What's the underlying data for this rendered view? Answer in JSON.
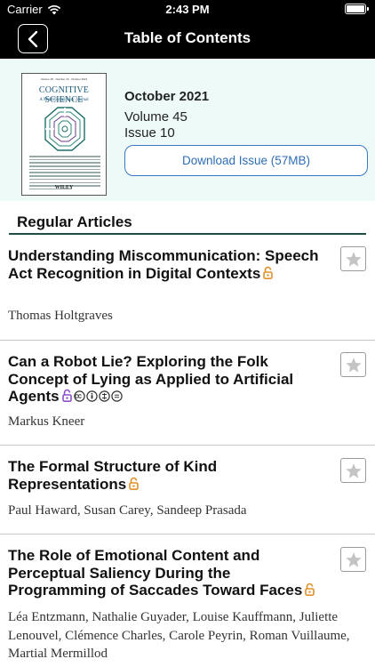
{
  "status_bar": {
    "carrier": "Carrier",
    "time": "2:43 PM"
  },
  "nav": {
    "title": "Table of Contents"
  },
  "issue": {
    "cover": {
      "top_text": "Volume 45 · Number 10 · October 2021",
      "journal_title": "COGNITIVE SCIENCE",
      "journal_subtitle": "A Multidisciplinary Journal",
      "publisher": "WILEY"
    },
    "date": "October 2021",
    "volume": "Volume 45",
    "issue": "Issue 10",
    "download_label": "Download Issue (57MB)"
  },
  "section": {
    "label": "Regular Articles"
  },
  "articles": [
    {
      "title": "Understanding Miscommunication: Speech Act Recognition in Digital Contexts",
      "authors": "Thomas Holtgraves",
      "access": "open-access-icon"
    },
    {
      "title": "Can a Robot Lie? Exploring the Folk Concept of Lying as Applied to Artificial Agents",
      "authors": "Markus Kneer",
      "access": "open-access-icon",
      "license": "cc-by-nc-nd-icon"
    },
    {
      "title": "The Formal Structure of Kind Representations",
      "authors": "Paul Haward, Susan Carey, Sandeep Prasada",
      "access": "open-access-icon"
    },
    {
      "title": "The Role of Emotional Content and Perceptual Saliency During the Programming of Saccades Toward Faces",
      "authors": "Léa Entzmann, Nathalie Guyader, Louise Kauffmann, Juliette Lenouvel, Clémence Charles, Carole Peyrin, Roman Vuillaume, Martial Mermillod",
      "access": "open-access-icon"
    }
  ],
  "colors": {
    "accent": "#2f6db5",
    "header_bg": "#eefaf8",
    "open_access": "#e0902a",
    "section_rule": "#1e4d44"
  }
}
